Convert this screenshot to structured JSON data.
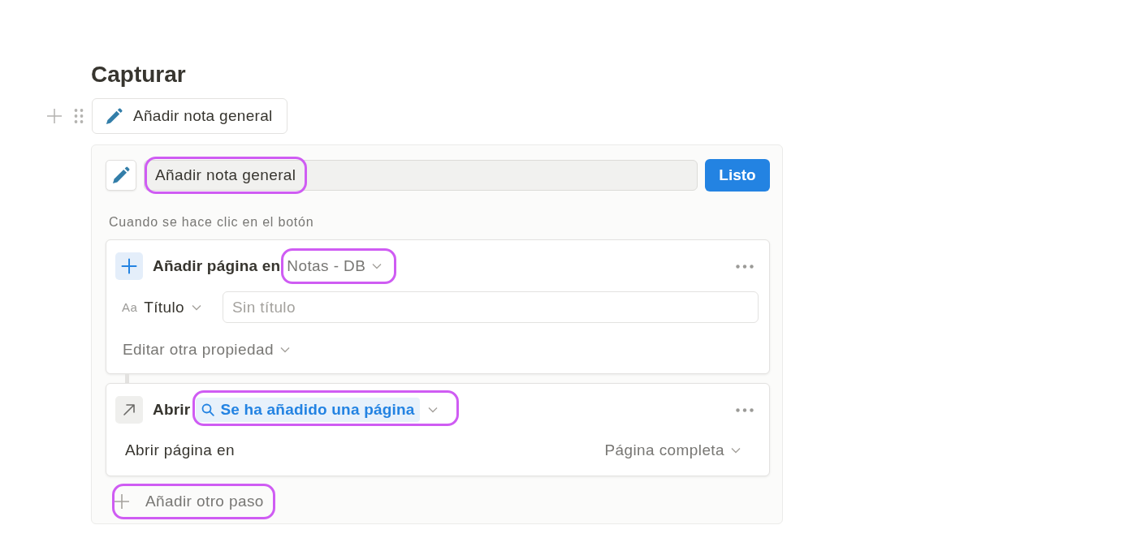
{
  "page": {
    "title": "Capturar"
  },
  "block": {
    "label": "Añadir nota general"
  },
  "editor": {
    "name_field": {
      "value": "Añadir nota general",
      "highlighted": true
    },
    "done_button": {
      "label": "Listo"
    },
    "trigger_label": "Cuando se hace clic en el botón",
    "steps": [
      {
        "kind": "add_page",
        "action": "Añadir página en",
        "target": {
          "label": "Notas - DB",
          "highlighted": true
        },
        "property": {
          "type_label": "Aa",
          "name": "Título",
          "placeholder": "Sin título"
        },
        "edit_more": "Editar otra propiedad"
      },
      {
        "kind": "open_page",
        "action": "Abrir",
        "target": {
          "label": "Se ha añadido una página",
          "highlighted": true
        },
        "option": {
          "label": "Abrir página en",
          "value": "Página completa"
        }
      }
    ],
    "add_step": {
      "label": "Añadir otro paso",
      "highlighted": true
    }
  }
}
